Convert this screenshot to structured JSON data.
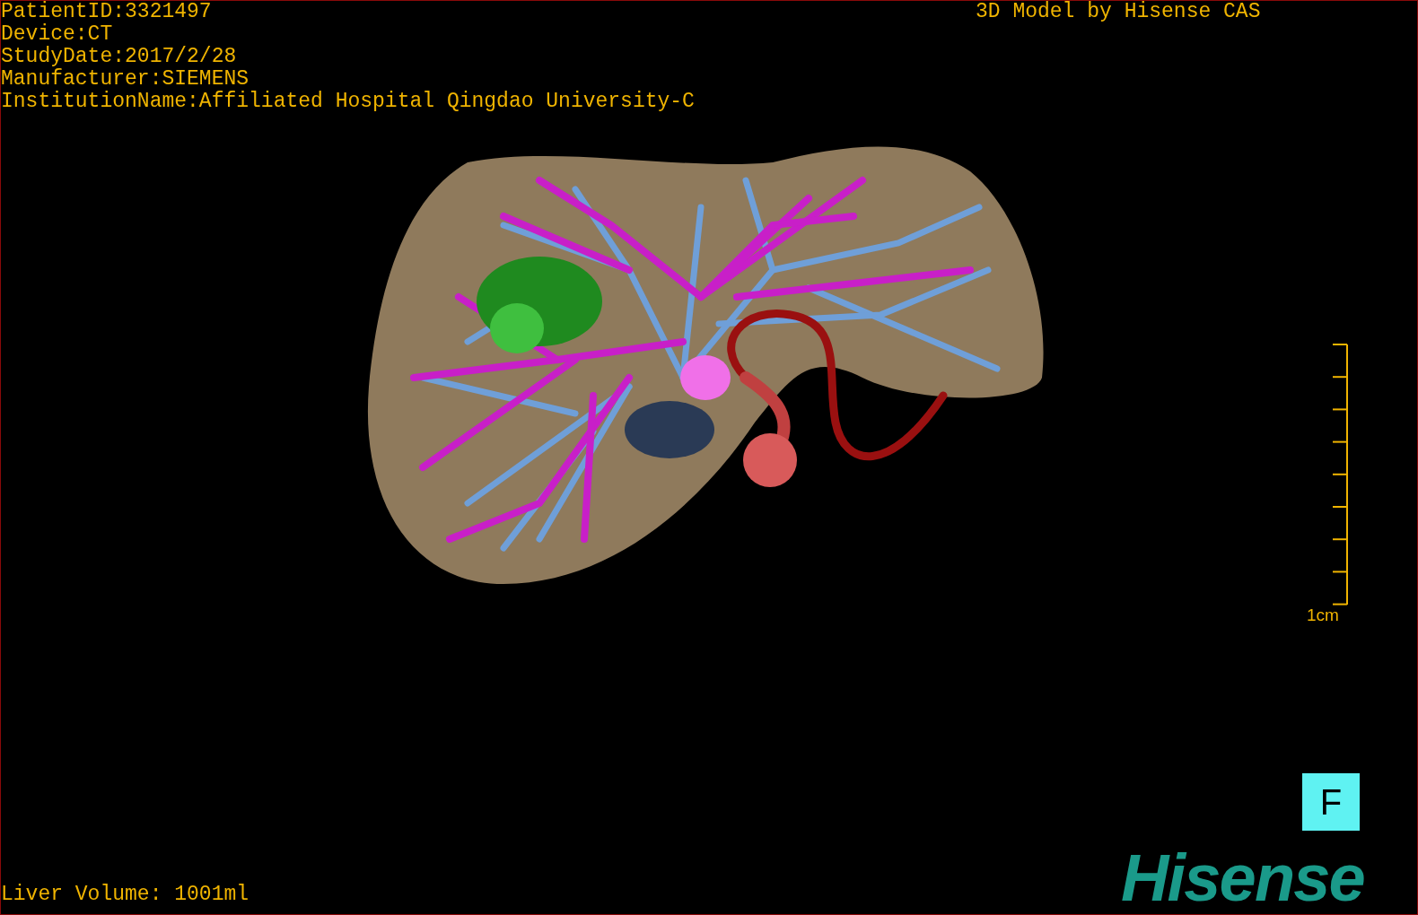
{
  "study_info": [
    "PatientID:3321497",
    "Device:CT",
    "StudyDate:2017/2/28",
    "Manufacturer:SIEMENS",
    "InstitutionName:Affiliated Hospital Qingdao University-C"
  ],
  "model_credit": "3D Model by Hisense CAS",
  "scale_bar": {
    "label": "1cm"
  },
  "view_button": "F",
  "liver_volume": "Liver Volume: 1001ml",
  "logo": "Hisense"
}
